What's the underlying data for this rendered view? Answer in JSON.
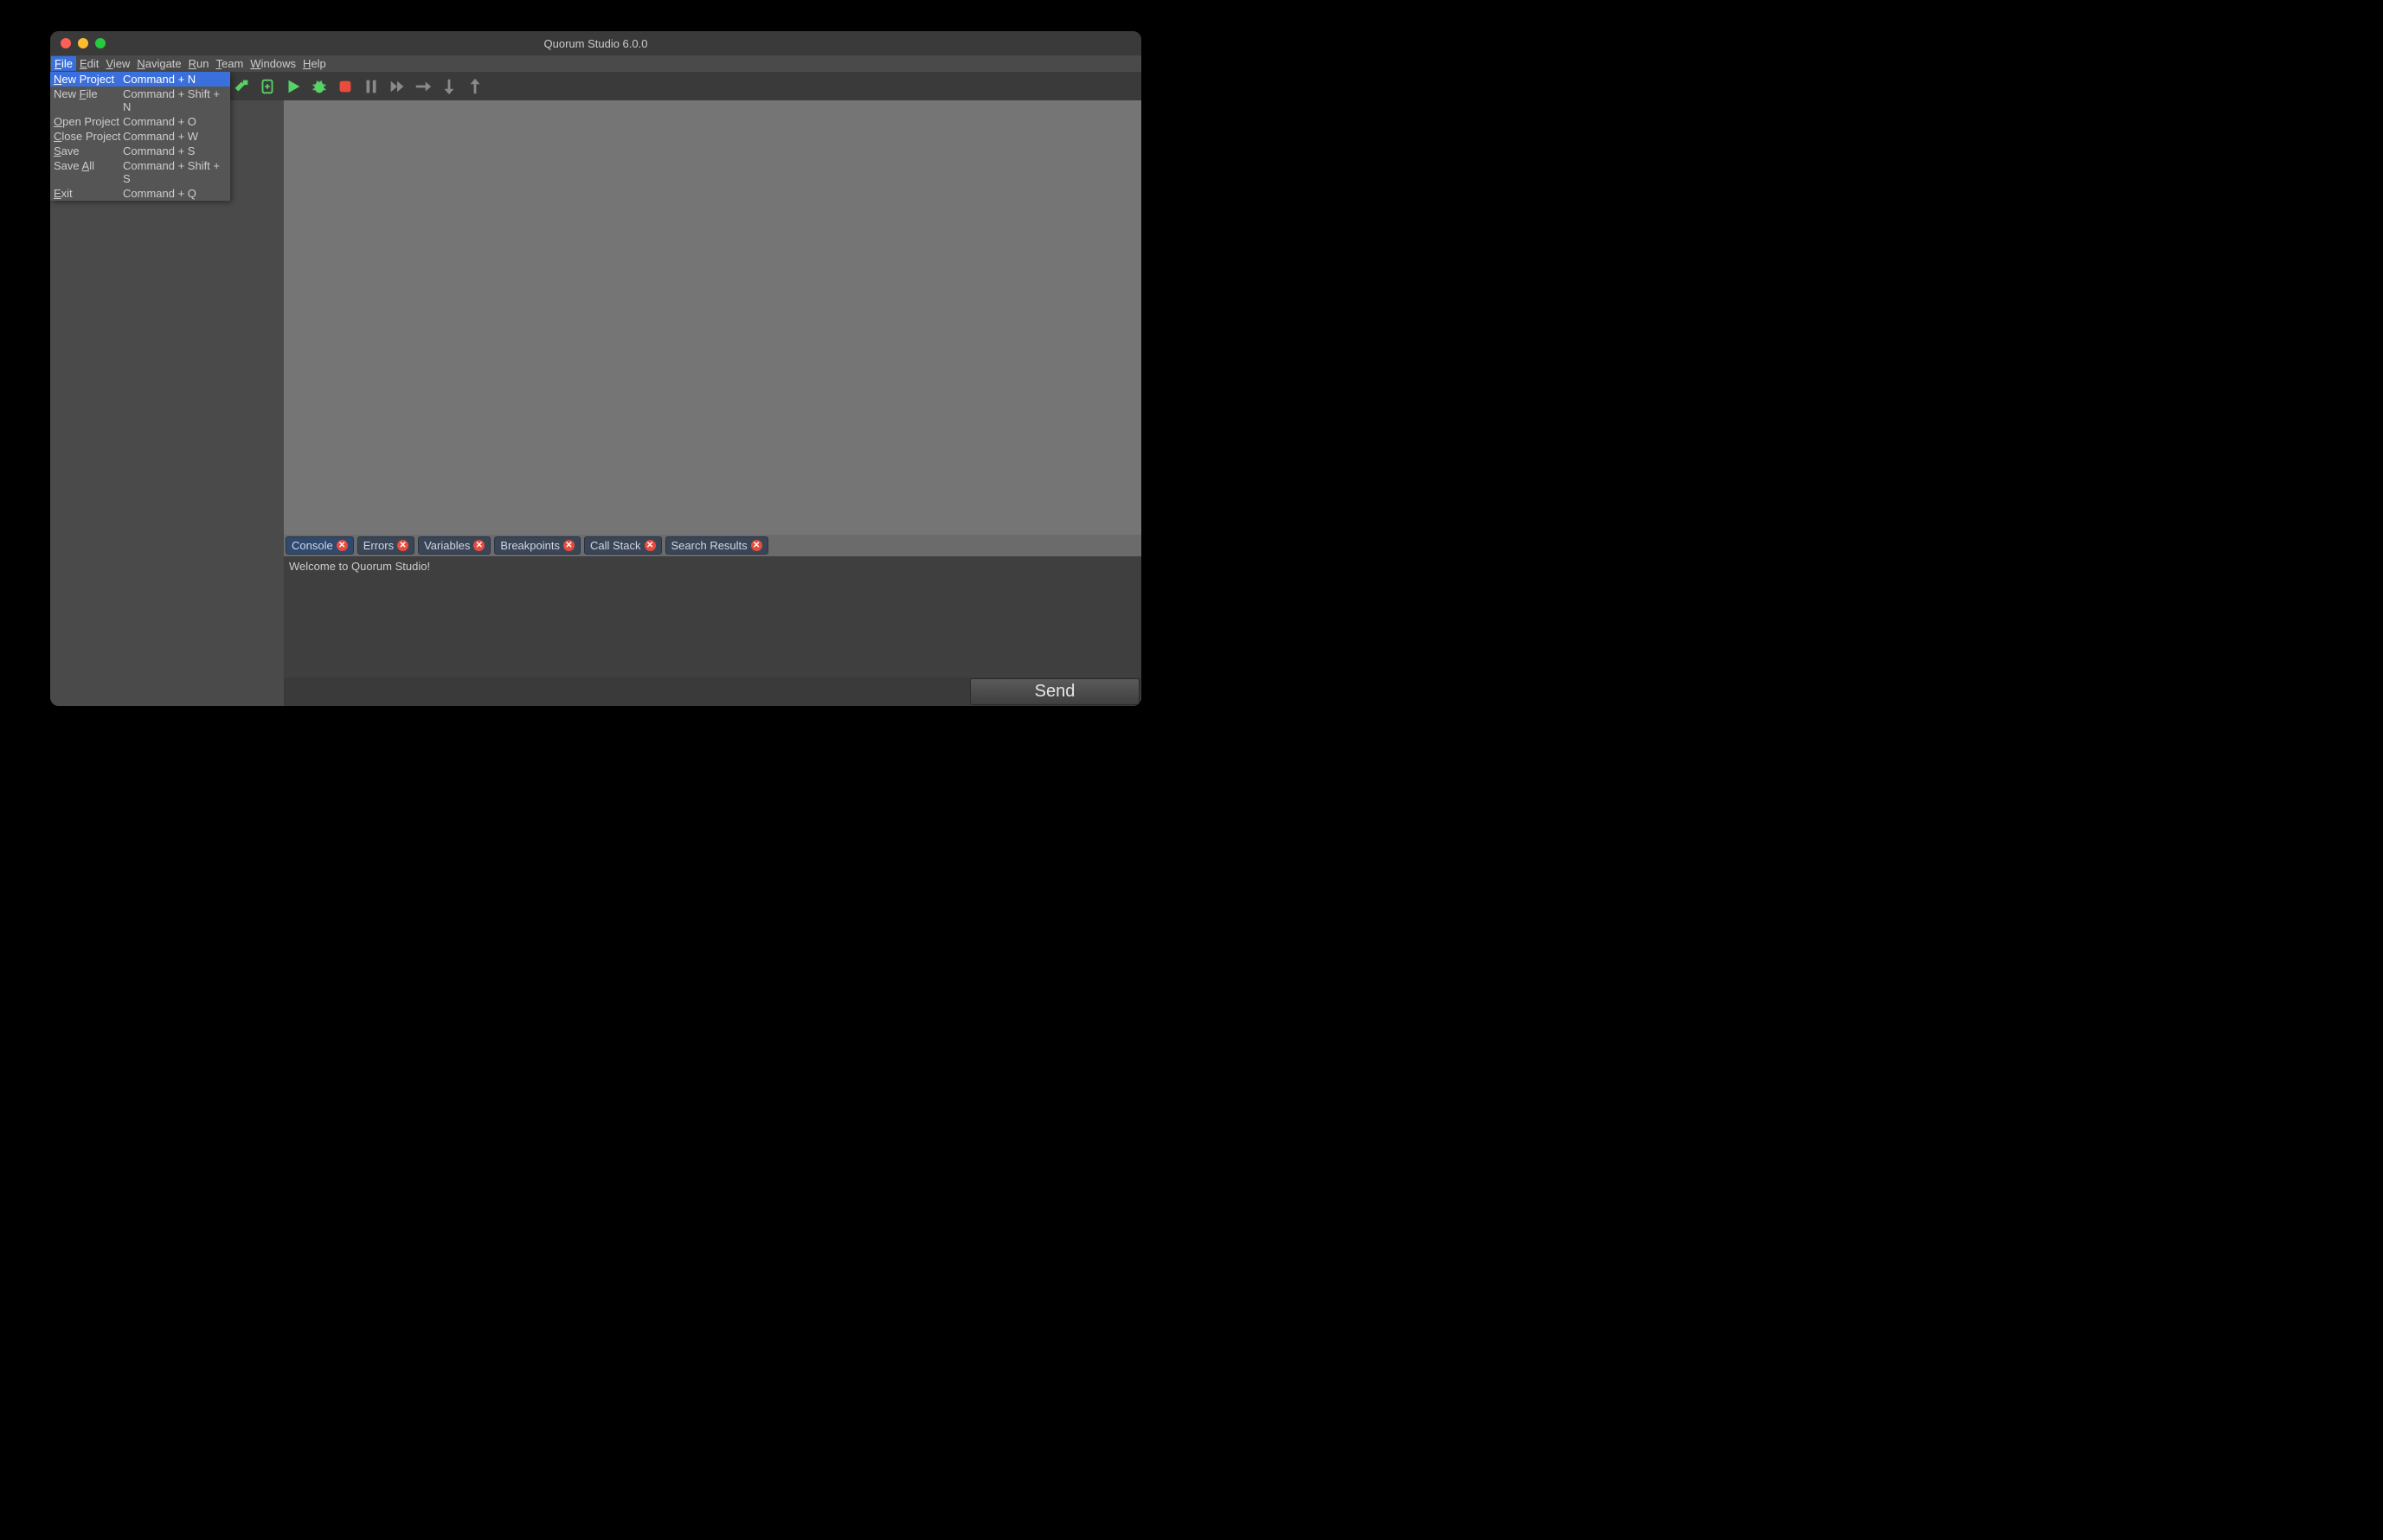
{
  "window": {
    "title": "Quorum Studio 6.0.0"
  },
  "menubar": {
    "items": [
      {
        "label": "File",
        "ul": "F",
        "rest": "ile",
        "active": true
      },
      {
        "label": "Edit",
        "ul": "E",
        "rest": "dit"
      },
      {
        "label": "View",
        "ul": "V",
        "rest": "iew"
      },
      {
        "label": "Navigate",
        "ul": "N",
        "rest": "avigate"
      },
      {
        "label": "Run",
        "ul": "R",
        "rest": "un"
      },
      {
        "label": "Team",
        "ul": "T",
        "rest": "eam"
      },
      {
        "label": "Windows",
        "ul": "W",
        "rest": "indows"
      },
      {
        "label": "Help",
        "ul": "H",
        "rest": "elp"
      }
    ]
  },
  "file_menu": {
    "rows": [
      {
        "pre": "",
        "ul": "N",
        "post": "ew Project",
        "shortcut": "Command + N",
        "selected": true
      },
      {
        "pre": "New ",
        "ul": "F",
        "post": "ile",
        "shortcut": "Command + Shift + N"
      },
      {
        "pre": "",
        "ul": "O",
        "post": "pen Project",
        "shortcut": "Command + O"
      },
      {
        "pre": "",
        "ul": "C",
        "post": "lose Project",
        "shortcut": "Command + W"
      },
      {
        "pre": "",
        "ul": "S",
        "post": "ave",
        "shortcut": "Command + S"
      },
      {
        "pre": "Save ",
        "ul": "A",
        "post": "ll",
        "shortcut": "Command + Shift + S"
      },
      {
        "pre": "",
        "ul": "E",
        "post": "xit",
        "shortcut": "Command + Q"
      }
    ]
  },
  "toolbar_icons": [
    "hammer-icon",
    "clean-icon",
    "play-icon",
    "bug-icon",
    "stop-icon",
    "pause-icon",
    "fast-forward-icon",
    "step-over-icon",
    "step-into-icon",
    "step-out-icon"
  ],
  "bottom_tabs": [
    {
      "label": "Console",
      "active": true
    },
    {
      "label": "Errors"
    },
    {
      "label": "Variables"
    },
    {
      "label": "Breakpoints"
    },
    {
      "label": "Call Stack"
    },
    {
      "label": "Search Results"
    }
  ],
  "console": {
    "text": "Welcome to Quorum Studio!"
  },
  "send": {
    "label": "Send"
  },
  "colors": {
    "green": "#56d364",
    "red": "#e74c3c",
    "gray": "#8a8a8a"
  }
}
